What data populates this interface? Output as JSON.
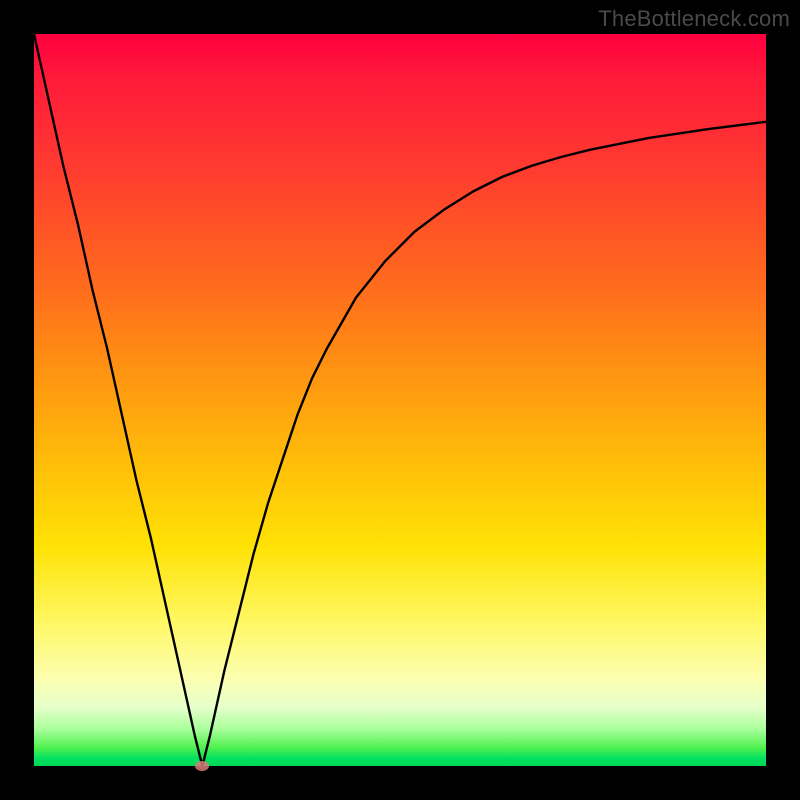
{
  "watermark": "TheBottleneck.com",
  "colors": {
    "frame": "#000000",
    "curve": "#000000",
    "marker": "#d97a7a",
    "gradient_top": "#ff0040",
    "gradient_bottom": "#00d856"
  },
  "chart_data": {
    "type": "line",
    "title": "",
    "xlabel": "",
    "ylabel": "",
    "xlim": [
      0,
      100
    ],
    "ylim": [
      0,
      100
    ],
    "x": [
      0,
      2,
      4,
      6,
      8,
      10,
      12,
      14,
      16,
      18,
      20,
      22,
      23,
      24,
      26,
      28,
      30,
      32,
      34,
      36,
      38,
      40,
      44,
      48,
      52,
      56,
      60,
      64,
      68,
      72,
      76,
      80,
      84,
      88,
      92,
      96,
      100
    ],
    "values": [
      100,
      91,
      82,
      74,
      65,
      57,
      48,
      39,
      31,
      22,
      13,
      4,
      0,
      4,
      13,
      21,
      29,
      36,
      42,
      48,
      53,
      57,
      64,
      69,
      73,
      76,
      78.5,
      80.5,
      82,
      83.2,
      84.2,
      85,
      85.8,
      86.4,
      87,
      87.5,
      88
    ],
    "marker": {
      "x": 23,
      "y": 0
    },
    "grid": false,
    "legend": false
  }
}
